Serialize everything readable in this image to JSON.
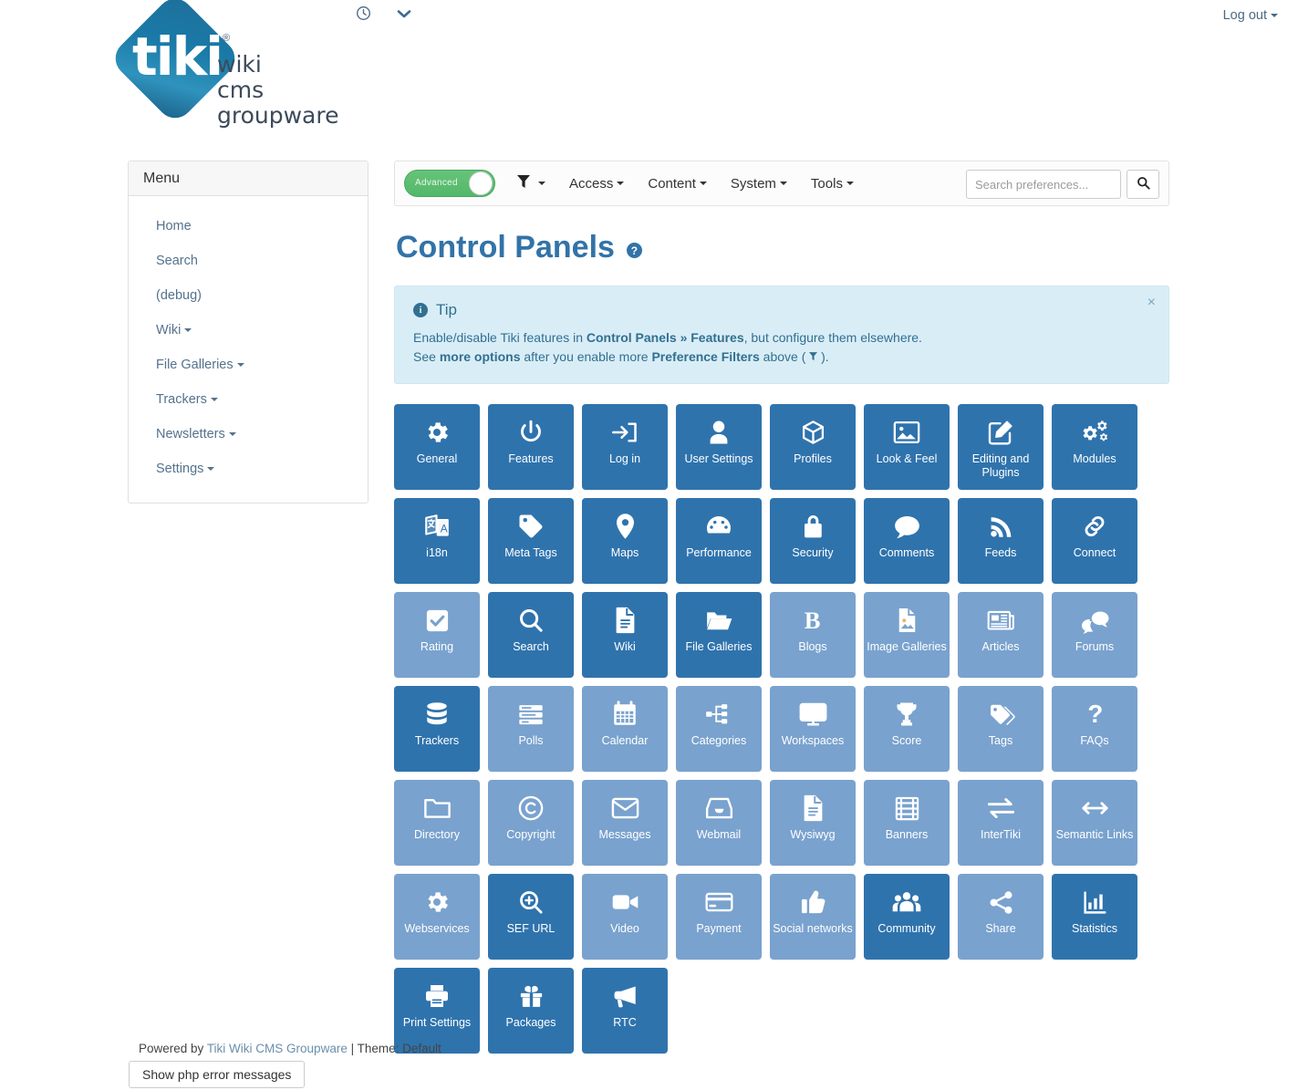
{
  "topbar": {
    "clock_icon": "clock-icon",
    "chevron_icon": "chevron-down-icon",
    "logout_label": "Log out"
  },
  "logo": {
    "mark": "tiki",
    "registered": "®",
    "line1": "wiki",
    "line2": "cms",
    "line3": "groupware"
  },
  "sidebar": {
    "title": "Menu",
    "items": [
      {
        "label": "Home",
        "caret": false
      },
      {
        "label": "Search",
        "caret": false
      },
      {
        "label": "(debug)",
        "caret": false
      },
      {
        "label": "Wiki",
        "caret": true
      },
      {
        "label": "File Galleries",
        "caret": true
      },
      {
        "label": "Trackers",
        "caret": true
      },
      {
        "label": "Newsletters",
        "caret": true
      },
      {
        "label": "Settings",
        "caret": true
      }
    ]
  },
  "toolbar": {
    "toggle_label": "Advanced",
    "toggle_state": "on",
    "filter_icon": "filter-icon",
    "menus": [
      {
        "label": "Access"
      },
      {
        "label": "Content"
      },
      {
        "label": "System"
      },
      {
        "label": "Tools"
      }
    ],
    "search_placeholder": "Search preferences...",
    "search_value": "",
    "search_icon": "search-icon"
  },
  "page": {
    "title": "Control Panels",
    "help_glyph": "?"
  },
  "tip": {
    "heading": "Tip",
    "close_glyph": "×",
    "line1_a": "Enable/disable Tiki features in ",
    "line1_b": "Control Panels » Features",
    "line1_c": ", but configure them elsewhere.",
    "line2_a": "See ",
    "line2_b": "more options",
    "line2_c": " after you enable more ",
    "line2_d": "Preference Filters",
    "line2_e": " above ( ",
    "line2_f": " )."
  },
  "colors": {
    "tile_enabled": "#2f73ad",
    "tile_disabled": "#79a2ce",
    "accent": "#3273a8",
    "tip_bg": "#d9edf7",
    "tip_text": "#31708f",
    "toggle_on": "#53b869"
  },
  "tiles": [
    {
      "label": "General",
      "icon": "gear-icon",
      "state": "on"
    },
    {
      "label": "Features",
      "icon": "power-icon",
      "state": "on"
    },
    {
      "label": "Log in",
      "icon": "sign-in-icon",
      "state": "on"
    },
    {
      "label": "User Settings",
      "icon": "user-icon",
      "state": "on"
    },
    {
      "label": "Profiles",
      "icon": "cube-icon",
      "state": "on"
    },
    {
      "label": "Look & Feel",
      "icon": "picture-icon",
      "state": "on"
    },
    {
      "label": "Editing and Plugins",
      "icon": "pencil-square-icon",
      "state": "on"
    },
    {
      "label": "Modules",
      "icon": "cogs-icon",
      "state": "on"
    },
    {
      "label": "i18n",
      "icon": "translate-icon",
      "state": "on"
    },
    {
      "label": "Meta Tags",
      "icon": "tag-icon",
      "state": "on"
    },
    {
      "label": "Maps",
      "icon": "map-marker-icon",
      "state": "on"
    },
    {
      "label": "Performance",
      "icon": "dashboard-icon",
      "state": "on"
    },
    {
      "label": "Security",
      "icon": "lock-icon",
      "state": "on"
    },
    {
      "label": "Comments",
      "icon": "comment-icon",
      "state": "on"
    },
    {
      "label": "Feeds",
      "icon": "rss-icon",
      "state": "on"
    },
    {
      "label": "Connect",
      "icon": "chain-icon",
      "state": "on"
    },
    {
      "label": "Rating",
      "icon": "check-square-icon",
      "state": "off"
    },
    {
      "label": "Search",
      "icon": "search-icon",
      "state": "on"
    },
    {
      "label": "Wiki",
      "icon": "file-text-icon",
      "state": "on"
    },
    {
      "label": "File Galleries",
      "icon": "folder-open-icon",
      "state": "on"
    },
    {
      "label": "Blogs",
      "icon": "bold-b-icon",
      "state": "off"
    },
    {
      "label": "Image Galleries",
      "icon": "file-image-icon",
      "state": "off"
    },
    {
      "label": "Articles",
      "icon": "newspaper-icon",
      "state": "off"
    },
    {
      "label": "Forums",
      "icon": "comments-icon",
      "state": "off"
    },
    {
      "label": "Trackers",
      "icon": "database-icon",
      "state": "on"
    },
    {
      "label": "Polls",
      "icon": "poll-icon",
      "state": "off"
    },
    {
      "label": "Calendar",
      "icon": "calendar-icon",
      "state": "off"
    },
    {
      "label": "Categories",
      "icon": "sitemap-icon",
      "state": "off"
    },
    {
      "label": "Workspaces",
      "icon": "desktop-icon",
      "state": "off"
    },
    {
      "label": "Score",
      "icon": "trophy-icon",
      "state": "off"
    },
    {
      "label": "Tags",
      "icon": "tags-icon",
      "state": "off"
    },
    {
      "label": "FAQs",
      "icon": "question-icon",
      "state": "off"
    },
    {
      "label": "Directory",
      "icon": "folder-icon",
      "state": "off"
    },
    {
      "label": "Copyright",
      "icon": "copyright-icon",
      "state": "off"
    },
    {
      "label": "Messages",
      "icon": "envelope-icon",
      "state": "off"
    },
    {
      "label": "Webmail",
      "icon": "inbox-icon",
      "state": "off"
    },
    {
      "label": "Wysiwyg",
      "icon": "file-lines-icon",
      "state": "off"
    },
    {
      "label": "Banners",
      "icon": "film-icon",
      "state": "off"
    },
    {
      "label": "InterTiki",
      "icon": "exchange-icon",
      "state": "off"
    },
    {
      "label": "Semantic Links",
      "icon": "arrows-h-icon",
      "state": "off"
    },
    {
      "label": "Webservices",
      "icon": "gear-icon",
      "state": "off"
    },
    {
      "label": "SEF URL",
      "icon": "search-plus-icon",
      "state": "on"
    },
    {
      "label": "Video",
      "icon": "video-camera-icon",
      "state": "off"
    },
    {
      "label": "Payment",
      "icon": "credit-card-icon",
      "state": "off"
    },
    {
      "label": "Social networks",
      "icon": "thumbs-up-icon",
      "state": "off"
    },
    {
      "label": "Community",
      "icon": "group-icon",
      "state": "on"
    },
    {
      "label": "Share",
      "icon": "share-alt-icon",
      "state": "off"
    },
    {
      "label": "Statistics",
      "icon": "bar-chart-icon",
      "state": "on"
    },
    {
      "label": "Print Settings",
      "icon": "print-icon",
      "state": "on"
    },
    {
      "label": "Packages",
      "icon": "gift-icon",
      "state": "on"
    },
    {
      "label": "RTC",
      "icon": "bullhorn-icon",
      "state": "on"
    }
  ],
  "footer": {
    "powered_prefix": "Powered by ",
    "powered_link": "Tiki Wiki CMS Groupware",
    "theme_text": " | Theme: Default",
    "php_button": "Show php error messages"
  }
}
